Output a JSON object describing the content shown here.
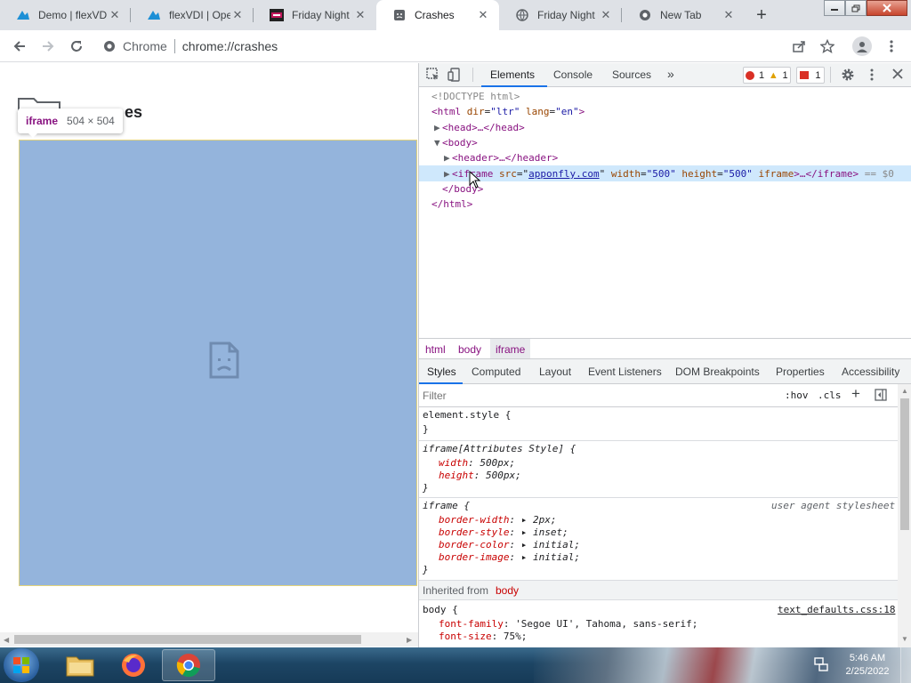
{
  "tabs": [
    {
      "title": "Demo | flexVDI",
      "icon": "flexvdi-icon",
      "active": false
    },
    {
      "title": "flexVDI | Open",
      "icon": "flexvdi-icon",
      "active": false
    },
    {
      "title": "Friday Night F",
      "icon": "fnf-icon",
      "active": false
    },
    {
      "title": "Crashes",
      "icon": "crashes-icon",
      "active": true
    },
    {
      "title": "Friday Night F",
      "icon": "globe-icon",
      "active": false
    },
    {
      "title": "New Tab",
      "icon": "chrome-icon",
      "active": false
    }
  ],
  "omnibox": {
    "site_label": "Chrome",
    "url": "chrome://crashes"
  },
  "page": {
    "heading_end": "es"
  },
  "tooltip": {
    "tag": "iframe",
    "size": "504 × 504"
  },
  "devtools": {
    "tabs": [
      "Elements",
      "Console",
      "Sources"
    ],
    "more": "»",
    "badges": {
      "errors": "1",
      "warnings": "1",
      "issues": "1"
    },
    "dom": {
      "doctype": "<!DOCTYPE html>",
      "html_open_tag": "<html",
      "html_attr1": "dir",
      "html_val1": "\"ltr\"",
      "html_attr2": "lang",
      "html_val2": "\"en\"",
      "head_line": "<head>…</head>",
      "body_open": "<body>",
      "header_line": "<header>…</header>",
      "iframe_tag": "<iframe",
      "iframe_src_attr": "src",
      "iframe_src_val": "apponfly.com",
      "iframe_width_attr": "width",
      "iframe_width_val": "\"500\"",
      "iframe_height_attr": "height",
      "iframe_height_val": "\"500\"",
      "iframe_extra_attr": "iframe",
      "iframe_close": ">…</iframe>",
      "eq": "== $0",
      "body_close": "</body>",
      "html_close": "</html>"
    },
    "breadcrumbs": [
      "html",
      "body",
      "iframe"
    ],
    "style_tabs": [
      "Styles",
      "Computed",
      "Layout",
      "Event Listeners",
      "DOM Breakpoints",
      "Properties",
      "Accessibility"
    ],
    "filter": {
      "placeholder": "Filter",
      "hov": ":hov",
      "cls": ".cls",
      "add": "+"
    },
    "rules": {
      "element_style": "element.style {",
      "close": "}",
      "attr_selector": "iframe[Attributes Style] {",
      "width_prop": "width",
      "width_val": "500px;",
      "height_prop": "height",
      "height_val": "500px;",
      "iframe_selector": "iframe {",
      "ua_label": "user agent stylesheet",
      "bw_prop": "border-width",
      "bw_val": "2px;",
      "bs_prop": "border-style",
      "bs_val": "inset;",
      "bc_prop": "border-color",
      "bc_val": "initial;",
      "bi_prop": "border-image",
      "bi_val": "initial;",
      "inherited_label": "Inherited from",
      "inherited_tag": "body",
      "body_selector": "body {",
      "body_source": "text_defaults.css:18",
      "ff_prop": "font-family",
      "ff_val": "'Segoe UI', Tahoma, sans-serif;",
      "fs_prop": "font-size",
      "fs_val": "75%;"
    }
  },
  "taskbar": {
    "time": "5:46 AM",
    "date": "2/25/2022"
  },
  "colors": {
    "accent": "#1a73e8",
    "iframe_highlight": "#94b4dc",
    "tag": "#881280",
    "attr": "#994500",
    "value": "#1a1aa6",
    "error": "#d93025"
  }
}
